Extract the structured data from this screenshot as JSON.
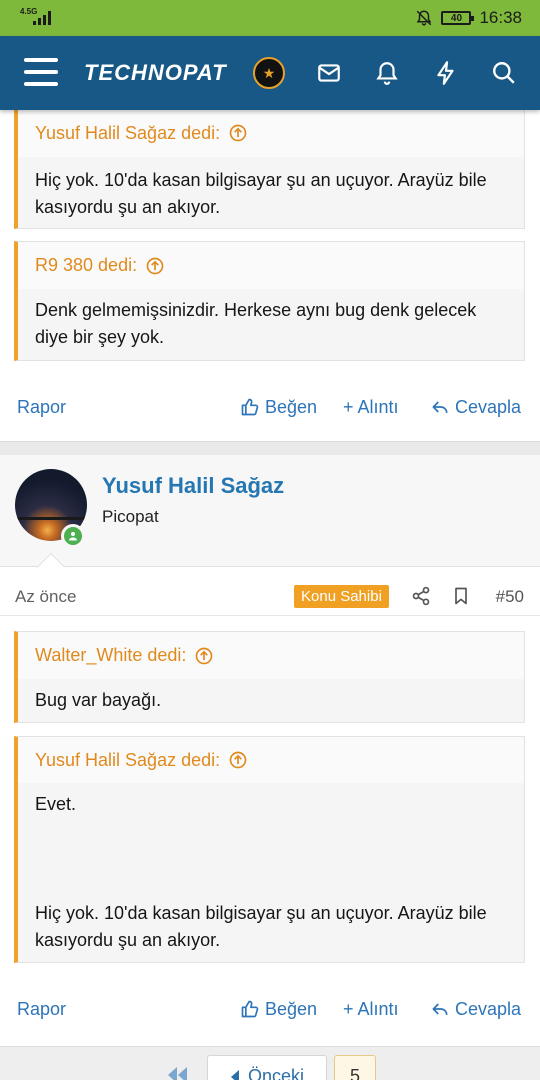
{
  "status_bar": {
    "network": "4.5G",
    "battery": "40",
    "time": "16:38"
  },
  "header": {
    "logo_text": "TECHNOPAT"
  },
  "post_prev": {
    "quotes": [
      {
        "author": "Yusuf Halil Sağaz dedi:",
        "text": "Hiç yok. 10'da kasan bilgisayar şu an uçuyor. Arayüz bile kasıyordu şu an akıyor."
      },
      {
        "author": "R9 380 dedi:",
        "text": "Denk gelmemişsinizdir. Herkese aynı bug denk gelecek diye bir şey yok."
      }
    ],
    "actions": {
      "report": "Rapor",
      "like": "Beğen",
      "quote": "+ Alıntı",
      "reply": "Cevapla"
    }
  },
  "post": {
    "username": "Yusuf Halil Sağaz",
    "user_title": "Picopat",
    "time": "Az önce",
    "badge": "Konu Sahibi",
    "number": "#50",
    "quotes": [
      {
        "author": "Walter_White dedi:",
        "text": "Bug var bayağı."
      },
      {
        "author": "Yusuf Halil Sağaz dedi:",
        "text_top": "Evet.",
        "text_bottom": "Hiç yok. 10'da kasan bilgisayar şu an uçuyor. Arayüz bile kasıyordu şu an akıyor."
      }
    ],
    "actions": {
      "report": "Rapor",
      "like": "Beğen",
      "quote": "+ Alıntı",
      "reply": "Cevapla"
    }
  },
  "pager": {
    "prev_label": "Önceki",
    "page": "5"
  },
  "colors": {
    "status_bar": "#7fb93c",
    "header": "#185886",
    "quote_accent": "#f0a12a",
    "link": "#2d74b8",
    "badge": "#f0a023"
  }
}
